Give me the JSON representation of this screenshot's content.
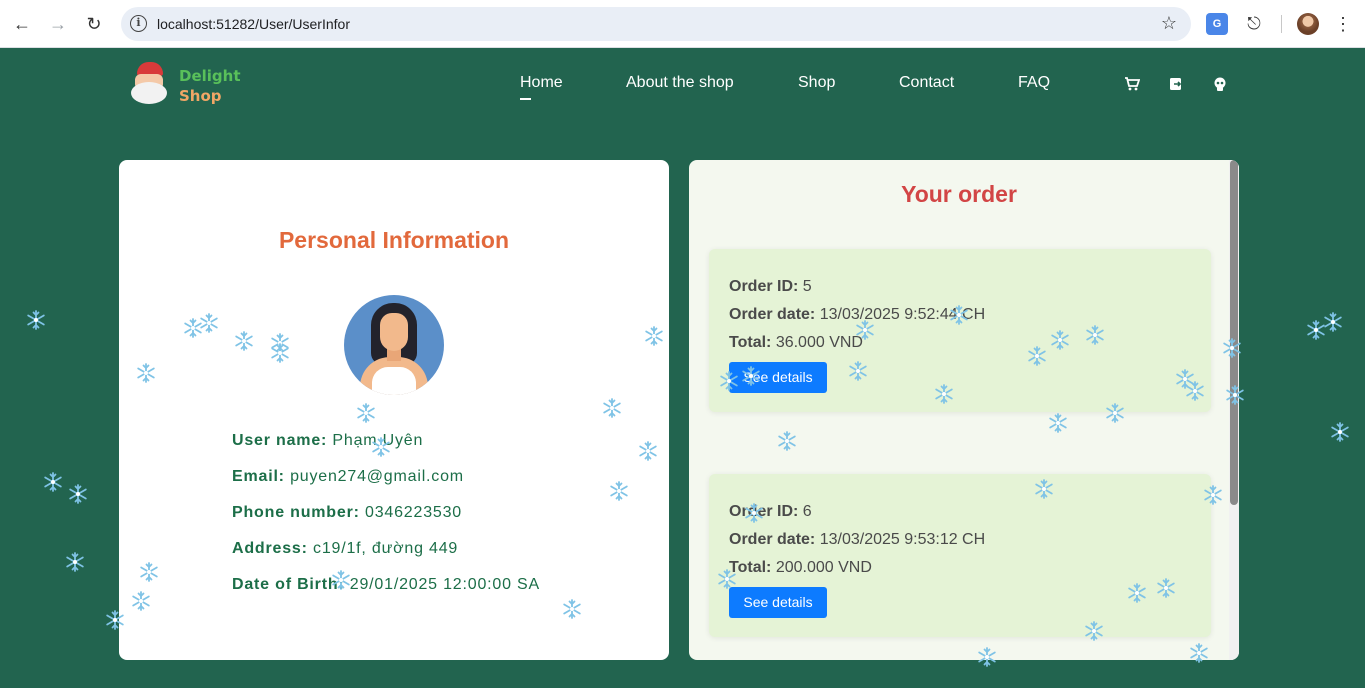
{
  "browser": {
    "url": "localhost:51282/User/UserInfor"
  },
  "site": {
    "logo": {
      "line1": "Delight",
      "line2": "Shop"
    },
    "nav": [
      "Home",
      "About the shop",
      "Shop",
      "Contact",
      "FAQ"
    ],
    "active_nav": "Home",
    "header_icons": [
      "cart-icon",
      "logout-icon",
      "user-icon"
    ]
  },
  "personal": {
    "title": "Personal Information",
    "fields": [
      {
        "label": "User name:",
        "value": "Phạm Uyên"
      },
      {
        "label": "Email:",
        "value": "puyen274@gmail.com"
      },
      {
        "label": "Phone number:",
        "value": "0346223530"
      },
      {
        "label": "Address:",
        "value": "c19/1f, đường 449"
      },
      {
        "label": "Date of Birth:",
        "value": "29/01/2025 12:00:00 SA"
      }
    ]
  },
  "orders": {
    "title": "Your order",
    "labels": {
      "id": "Order ID:",
      "date": "Order date:",
      "total": "Total:",
      "button": "See details"
    },
    "items": [
      {
        "id": "5",
        "date": "13/03/2025 9:52:44 CH",
        "total": "36.000 VND"
      },
      {
        "id": "6",
        "date": "13/03/2025 9:53:12 CH",
        "total": "200.000 VND"
      }
    ]
  },
  "colors": {
    "background": "#22644f",
    "personal_title": "#e2693c",
    "order_title": "#d24545",
    "info_text": "#1c6e48",
    "button": "#0d7bff",
    "order_card": "#e5f3d6"
  }
}
